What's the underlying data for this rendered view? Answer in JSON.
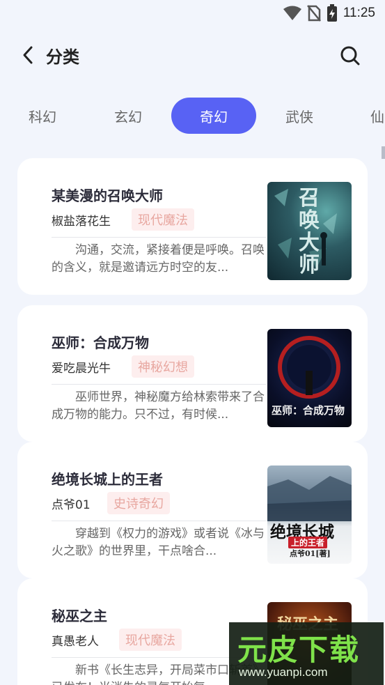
{
  "status": {
    "time": "11:25",
    "icons": [
      "wifi-icon",
      "no-sim-icon",
      "battery-charging-icon"
    ]
  },
  "header": {
    "title": "分类",
    "back_icon": "chevron-left-icon",
    "search_icon": "search-icon"
  },
  "tabs": [
    {
      "label": "科幻",
      "active": false
    },
    {
      "label": "玄幻",
      "active": false
    },
    {
      "label": "奇幻",
      "active": true
    },
    {
      "label": "武侠",
      "active": false
    },
    {
      "label": "仙",
      "active": false
    }
  ],
  "colors": {
    "accent": "#5862f4",
    "tag_bg": "#fdeeee",
    "tag_text": "#e8a7a0",
    "background": "#f2f5fc"
  },
  "books": [
    {
      "title": "某美漫的召唤大师",
      "author": "椒盐落花生",
      "tag": "现代魔法",
      "description": "沟通，交流，紧接着便是呼唤。召唤的含义，就是邀请远方时空的友...",
      "cover_text": "召唤大师"
    },
    {
      "title": "巫师：合成万物",
      "author": "爱吃晨光牛",
      "tag": "神秘幻想",
      "description": "巫师世界，神秘魔方给林索带来了合成万物的能力。只不过，有时候...",
      "cover_text": "巫师：合成万物"
    },
    {
      "title": "绝境长城上的王者",
      "author": "点爷01",
      "tag": "史诗奇幻",
      "description": "穿越到《权力的游戏》或者说《冰与火之歌》的世界里，干点啥合...",
      "cover_text": "绝境长城",
      "cover_sub": "上的王者",
      "cover_author": "点爷01[著]"
    },
    {
      "title": "秘巫之主",
      "author": "真愚老人",
      "tag": "现代魔法",
      "description": "新书《长生志异，开局菜市口斩首》已发布！当消失的灵气开始复...",
      "cover_text": "秘巫之主"
    }
  ],
  "watermark": {
    "brand": "元皮下载",
    "url": "www.yuanpi.com"
  }
}
